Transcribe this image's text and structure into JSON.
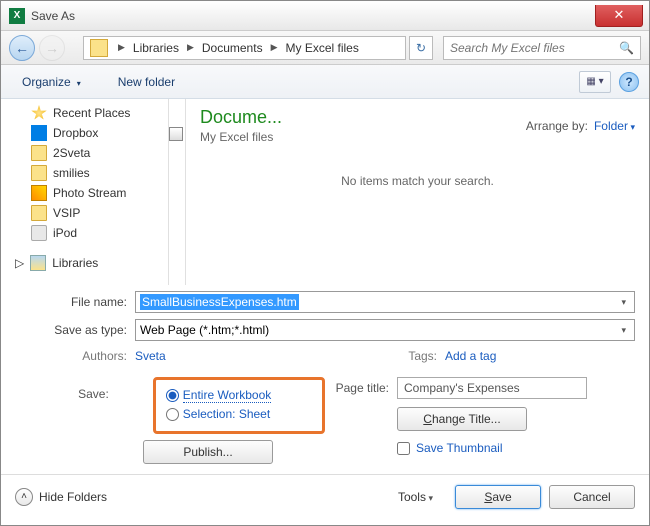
{
  "window": {
    "title": "Save As"
  },
  "nav": {
    "segments": [
      "Libraries",
      "Documents",
      "My Excel files"
    ],
    "search_placeholder": "Search My Excel files"
  },
  "toolbar": {
    "organize": "Organize",
    "new_folder": "New folder"
  },
  "tree": {
    "items": [
      {
        "label": "Recent Places",
        "icon": "star"
      },
      {
        "label": "Dropbox",
        "icon": "dropbox"
      },
      {
        "label": "2Sveta",
        "icon": "folder"
      },
      {
        "label": "smilies",
        "icon": "folder"
      },
      {
        "label": "Photo Stream",
        "icon": "photo"
      },
      {
        "label": "VSIP",
        "icon": "folder"
      },
      {
        "label": "iPod",
        "icon": "ipod"
      }
    ],
    "libraries": "Libraries"
  },
  "content": {
    "title": "Docume...",
    "subtitle": "My Excel files",
    "arrange_label": "Arrange by:",
    "arrange_value": "Folder",
    "empty": "No items match your search."
  },
  "form": {
    "filename_label": "File name:",
    "filename_value": "SmallBusinessExpenses.htm",
    "savetype_label": "Save as type:",
    "savetype_value": "Web Page (*.htm;*.html)",
    "authors_label": "Authors:",
    "authors_value": "Sveta",
    "tags_label": "Tags:",
    "tags_value": "Add a tag",
    "save_label": "Save:",
    "radio_workbook": "Entire Workbook",
    "radio_selection": "Selection: Sheet",
    "publish": "Publish...",
    "pagetitle_label": "Page title:",
    "pagetitle_value": "Company's Expenses",
    "change_title": "Change Title...",
    "save_thumb": "Save Thumbnail"
  },
  "footer": {
    "hide": "Hide Folders",
    "tools": "Tools",
    "save": "Save",
    "cancel": "Cancel"
  }
}
